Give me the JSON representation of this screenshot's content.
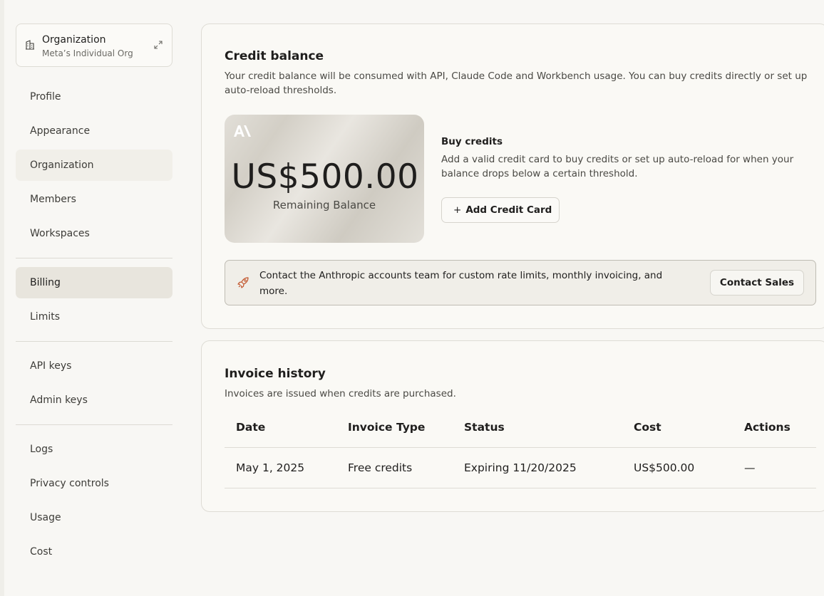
{
  "sidebar": {
    "org": {
      "title": "Organization",
      "subtitle": "Meta’s Individual Org"
    },
    "items": [
      {
        "label": "Profile"
      },
      {
        "label": "Appearance"
      },
      {
        "label": "Organization"
      },
      {
        "label": "Members"
      },
      {
        "label": "Workspaces"
      },
      {
        "label": "Billing"
      },
      {
        "label": "Limits"
      },
      {
        "label": "API keys"
      },
      {
        "label": "Admin keys"
      },
      {
        "label": "Logs"
      },
      {
        "label": "Privacy controls"
      },
      {
        "label": "Usage"
      },
      {
        "label": "Cost"
      }
    ]
  },
  "credit": {
    "title": "Credit balance",
    "description": "Your credit balance will be consumed with API, Claude Code and Workbench usage. You can buy credits directly or set up auto-reload thresholds.",
    "balance_amount": "US$500.00",
    "balance_label": "Remaining Balance",
    "buy_title": "Buy credits",
    "buy_description": "Add a valid credit card to buy credits or set up auto-reload for when your balance drops below a certain threshold.",
    "add_card_label": "Add Credit Card",
    "contact_text": "Contact the Anthropic accounts team for custom rate limits, monthly invoicing, and more.",
    "contact_button": "Contact Sales"
  },
  "invoice": {
    "title": "Invoice history",
    "description": "Invoices are issued when credits are purchased.",
    "columns": [
      "Date",
      "Invoice Type",
      "Status",
      "Cost",
      "Actions"
    ],
    "rows": [
      {
        "date": "May 1, 2025",
        "type": "Free credits",
        "status": "Expiring 11/20/2025",
        "cost": "US$500.00",
        "actions": "—"
      }
    ]
  }
}
